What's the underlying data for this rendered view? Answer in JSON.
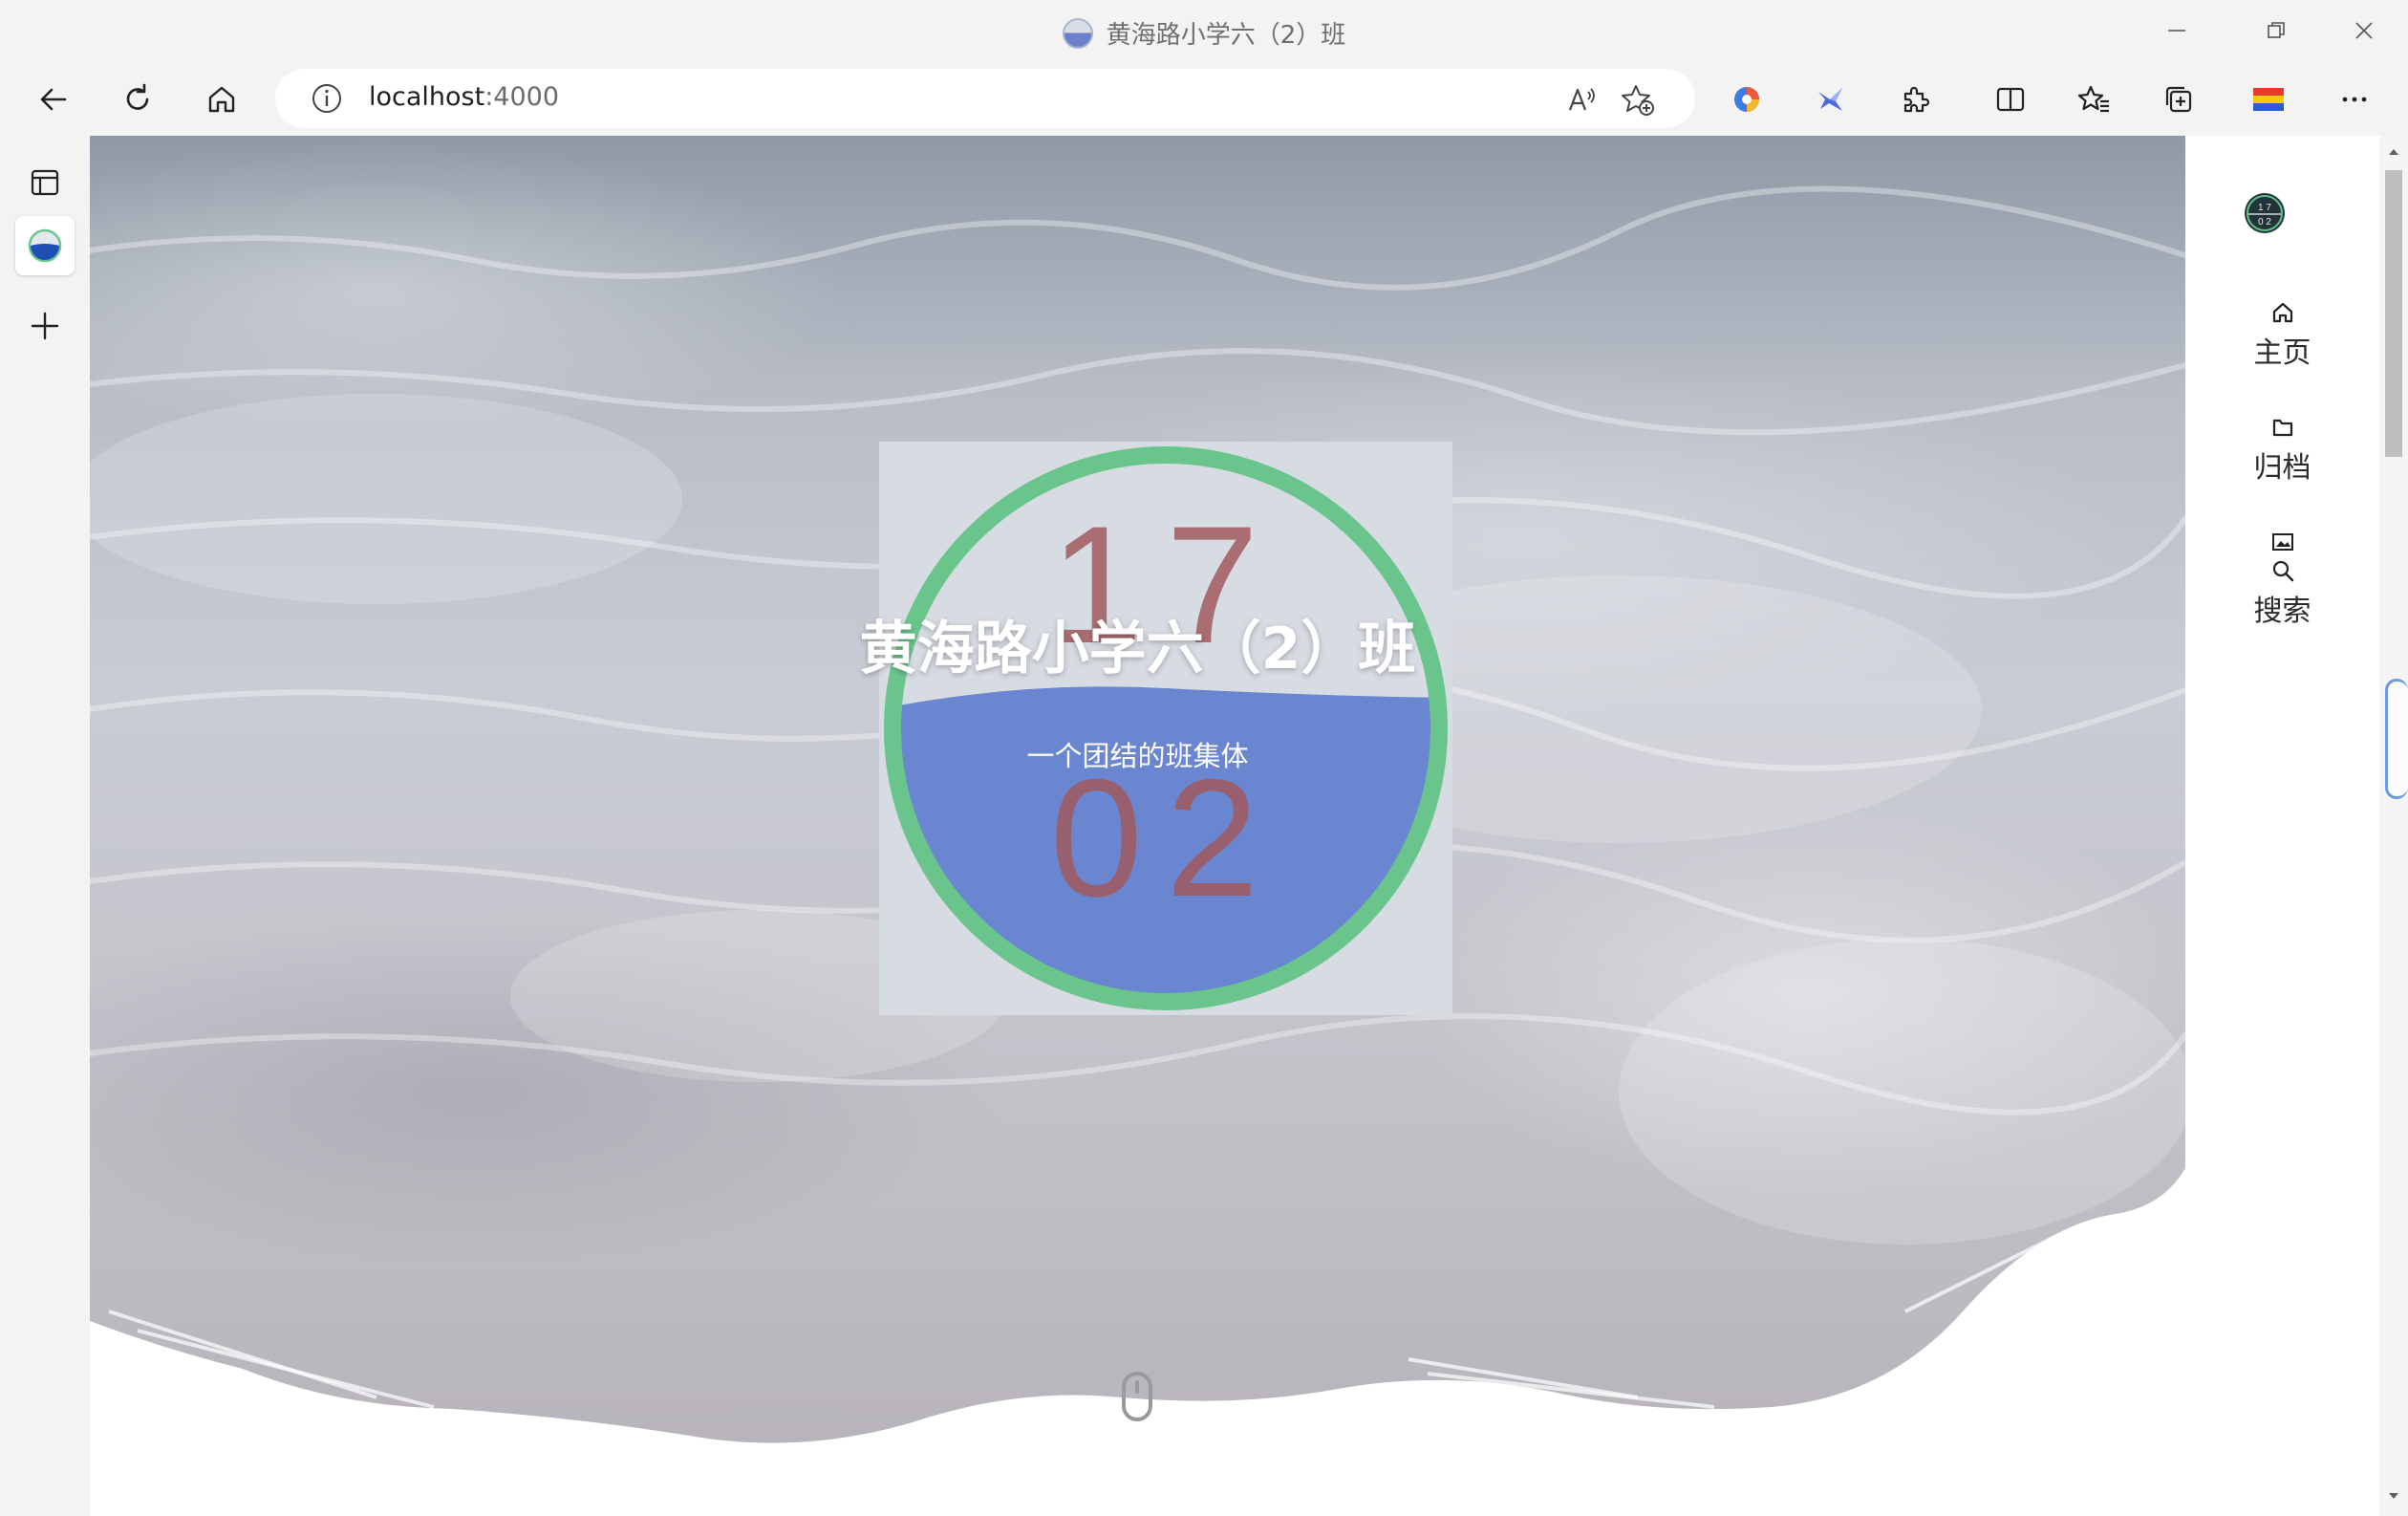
{
  "window": {
    "title": "黄海路小学六（2）班",
    "controls": [
      "minimize",
      "restore",
      "close"
    ]
  },
  "toolbar": {
    "url_host": "localhost",
    "url_port": ":4000",
    "icons": [
      "back-icon",
      "refresh-icon",
      "home-icon",
      "info-icon",
      "read-aloud-icon",
      "add-favorite-icon",
      "extension-color-icon",
      "extension-bird-icon",
      "extensions-icon",
      "split-screen-icon",
      "favorites-icon",
      "collections-icon",
      "flag-icon",
      "more-icon"
    ]
  },
  "tabs": {
    "icons": [
      "tab-actions-icon",
      "site-tab-icon",
      "new-tab-icon"
    ]
  },
  "hero": {
    "logo_top": "17",
    "logo_bottom": "02",
    "title": "黄海路小学六（2）班",
    "subtitle": "一个团结的班集体"
  },
  "sitenav": {
    "items": [
      {
        "label": "主页",
        "icon": "home-icon"
      },
      {
        "label": "归档",
        "icon": "folder-icon"
      },
      {
        "label": "搜索",
        "icon": "search-icon"
      }
    ]
  },
  "colors": {
    "chrome_bg": "#f3f3f3",
    "logo_ring": "#6ac58c",
    "logo_water": "#6a86d0",
    "logo_digits": "#a15a5f"
  }
}
